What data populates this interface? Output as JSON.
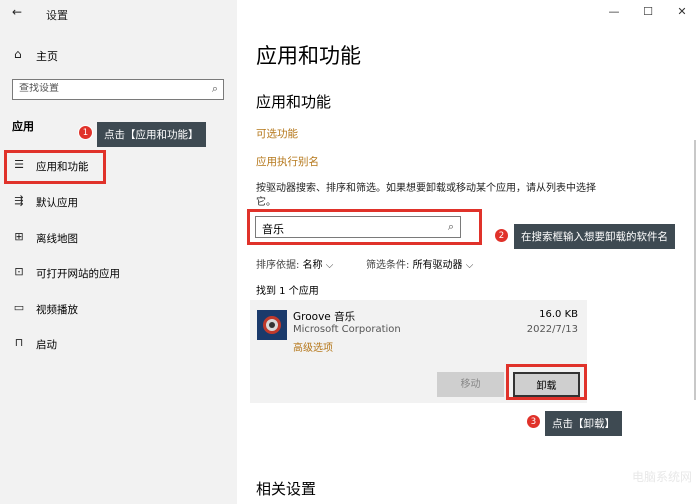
{
  "window": {
    "back_icon": "←",
    "app_title": "设置",
    "minimize": "—",
    "maximize": "☐",
    "close": "✕"
  },
  "sidebar": {
    "home": {
      "icon": "⌂",
      "label": "主页"
    },
    "search_placeholder": "查找设置",
    "section_label": "应用",
    "items": [
      {
        "icon": "☰",
        "label": "应用和功能",
        "active": true
      },
      {
        "icon": "⇶",
        "label": "默认应用"
      },
      {
        "icon": "⊞",
        "label": "离线地图"
      },
      {
        "icon": "⊡",
        "label": "可打开网站的应用"
      },
      {
        "icon": "▭",
        "label": "视频播放"
      },
      {
        "icon": "⊓",
        "label": "启动"
      }
    ]
  },
  "main": {
    "page_title": "应用和功能",
    "sub_title": "应用和功能",
    "link_optional": "可选功能",
    "link_aliases": "应用执行别名",
    "description": "按驱动器搜索、排序和筛选。如果想要卸载或移动某个应用，请从列表中选择它。",
    "search_value": "音乐",
    "sort_label": "排序依据:",
    "sort_value": "名称",
    "filter_label": "筛选条件:",
    "filter_value": "所有驱动器",
    "found_text": "找到 1 个应用",
    "app": {
      "name": "Groove 音乐",
      "publisher": "Microsoft Corporation",
      "advanced": "高级选项",
      "size": "16.0 KB",
      "date": "2022/7/13",
      "move_label": "移动",
      "uninstall_label": "卸载"
    },
    "related_title": "相关设置",
    "watermark": "电脑系统网"
  },
  "annotations": [
    {
      "number": "1",
      "text": "点击【应用和功能】"
    },
    {
      "number": "2",
      "text": "在搜索框输入想要卸载的软件名"
    },
    {
      "number": "3",
      "text": "点击【卸载】"
    }
  ],
  "colors": {
    "accent": "#1f6fd0",
    "link": "#b5771a",
    "highlight": "#e0322a",
    "callout_bg": "#3e4a52"
  }
}
